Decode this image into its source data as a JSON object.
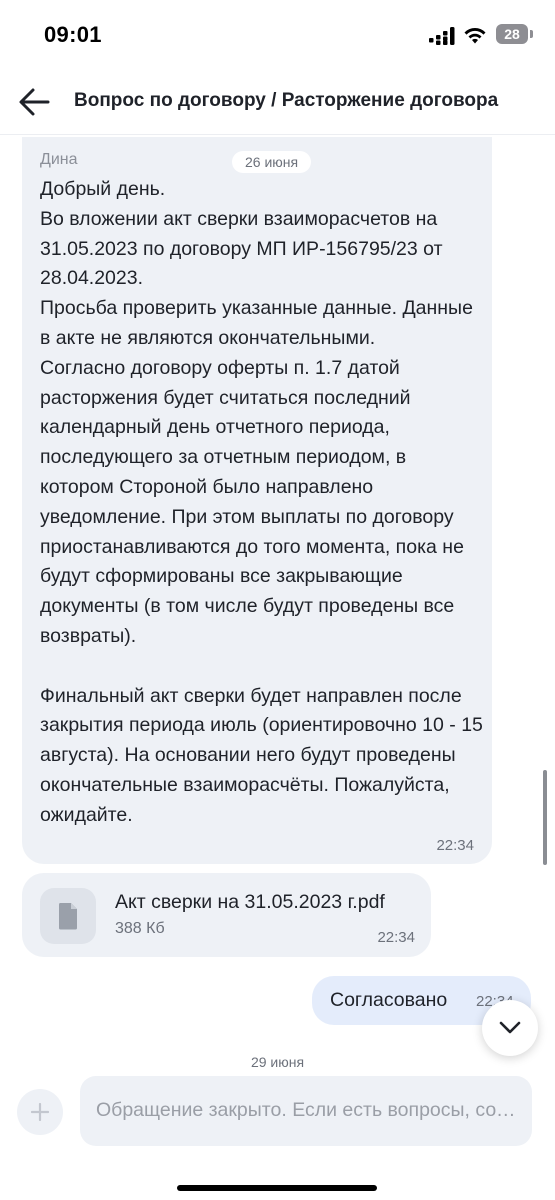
{
  "status_bar": {
    "time": "09:01",
    "battery_level": "28",
    "icons": [
      "cellular-signal-icon",
      "wifi-icon",
      "battery-icon"
    ]
  },
  "header": {
    "back_icon": "arrow-left-icon",
    "title": "Вопрос по договору / Расторжение договора"
  },
  "messages": {
    "incoming": {
      "sender": "Дина",
      "date": "26 июня",
      "text": "Добрый день.\nВо вложении акт сверки взаиморасчетов на 31.05.2023 по договору МП ИР-156795/23 от 28.04.2023.\nПросьба проверить указанные данные. Данные в акте не являются окончательными.\nСогласно договору оферты п. 1.7 датой расторжения будет считаться последний календарный день отчетного периода, последующего за отчетным периодом, в котором Стороной было направлено уведомление. При этом выплаты по договору приостанавливаются до того момента, пока не будут сформированы все закрывающие документы (в том числе будут проведены все возвраты).\n\nФинальный акт сверки будет направлен после закрытия периода июль (ориентировочно 10 - 15 августа). На основании него будут проведены окончательные взаиморасчёты. Пожалуйста, ожидайте.",
      "time": "22:34"
    },
    "attachment": {
      "icon": "document-icon",
      "file_name": "Акт сверки на 31.05.2023 г.pdf",
      "file_size": "388 Кб",
      "time": "22:34"
    },
    "outgoing": {
      "text": "Согласовано",
      "time": "22:34"
    },
    "date_separator": "29 июня"
  },
  "composer": {
    "add_icon": "plus-icon",
    "placeholder": "Обращение закрыто. Если есть вопросы, создайте новое обращение"
  },
  "scroll_down_icon": "chevron-down-icon",
  "colors": {
    "incoming_bubble": "#eef1f6",
    "outgoing_bubble": "#e4ecfb",
    "text": "#1f2229",
    "muted": "#6c717b"
  }
}
